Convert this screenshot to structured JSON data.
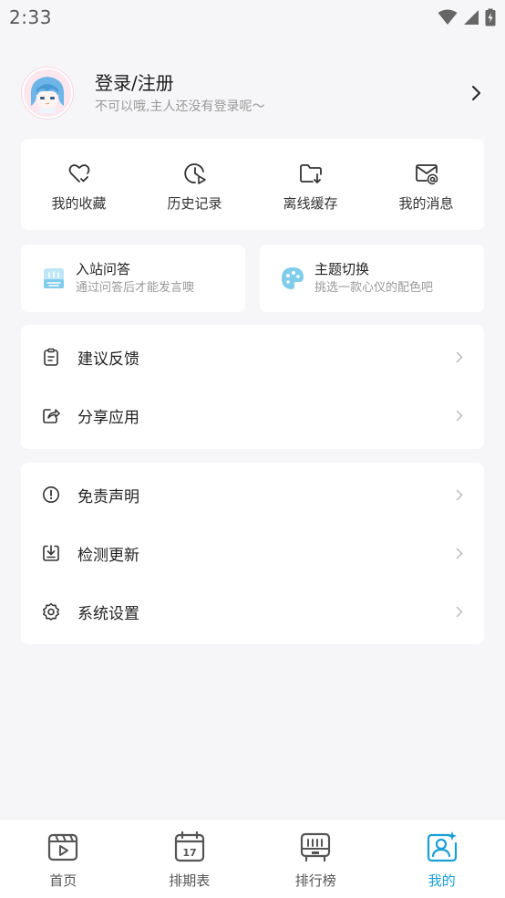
{
  "status_bar": {
    "time": "2:33"
  },
  "profile": {
    "title": "登录/注册",
    "subtitle": "不可以哦,主人还没有登录呢～"
  },
  "quick_actions": [
    {
      "label": "我的收藏",
      "icon": "heart-check-icon"
    },
    {
      "label": "历史记录",
      "icon": "clock-play-icon"
    },
    {
      "label": "离线缓存",
      "icon": "folder-download-icon"
    },
    {
      "label": "我的消息",
      "icon": "mail-at-icon"
    }
  ],
  "features": [
    {
      "title": "入站问答",
      "subtitle": "通过问答后才能发言噢",
      "icon": "quiz-icon"
    },
    {
      "title": "主题切换",
      "subtitle": "挑选一款心仪的配色吧",
      "icon": "palette-icon"
    }
  ],
  "menu_group_1": [
    {
      "label": "建议反馈",
      "icon": "clipboard-icon"
    },
    {
      "label": "分享应用",
      "icon": "share-icon"
    }
  ],
  "menu_group_2": [
    {
      "label": "免责声明",
      "icon": "info-circle-icon"
    },
    {
      "label": "检测更新",
      "icon": "download-box-icon"
    },
    {
      "label": "系统设置",
      "icon": "gear-icon"
    }
  ],
  "bottom_nav": [
    {
      "label": "首页",
      "icon": "video-home-icon",
      "active": false
    },
    {
      "label": "排期表",
      "icon": "calendar-17-icon",
      "active": false
    },
    {
      "label": "排行榜",
      "icon": "ranking-icon",
      "active": false
    },
    {
      "label": "我的",
      "icon": "profile-sparkle-icon",
      "active": true
    }
  ],
  "colors": {
    "accent": "#1a9fd8",
    "background": "#f6f6f8",
    "card": "#ffffff",
    "feature_icon": "#7fcdeb"
  },
  "calendar_day": "17"
}
